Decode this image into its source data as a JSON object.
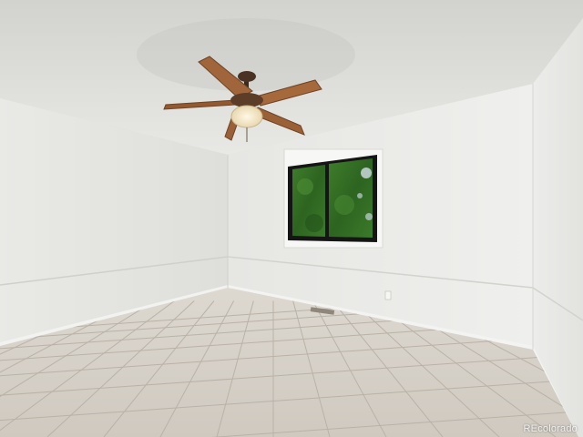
{
  "photo": {
    "subject": "empty-bedroom",
    "watermark": "REcolorado"
  },
  "colors": {
    "ceiling": "#e4e4e0",
    "wall_left": "#e3e3df",
    "wall_back": "#ececea",
    "wall_right": "#e6e6e3",
    "floor_tile": "#d6d1c9",
    "grout": "#b9b2a8",
    "fan_blade": "#a0653a",
    "fan_light": "#f4ead0",
    "foliage": "#2f6a24",
    "window_frame": "#151515"
  }
}
